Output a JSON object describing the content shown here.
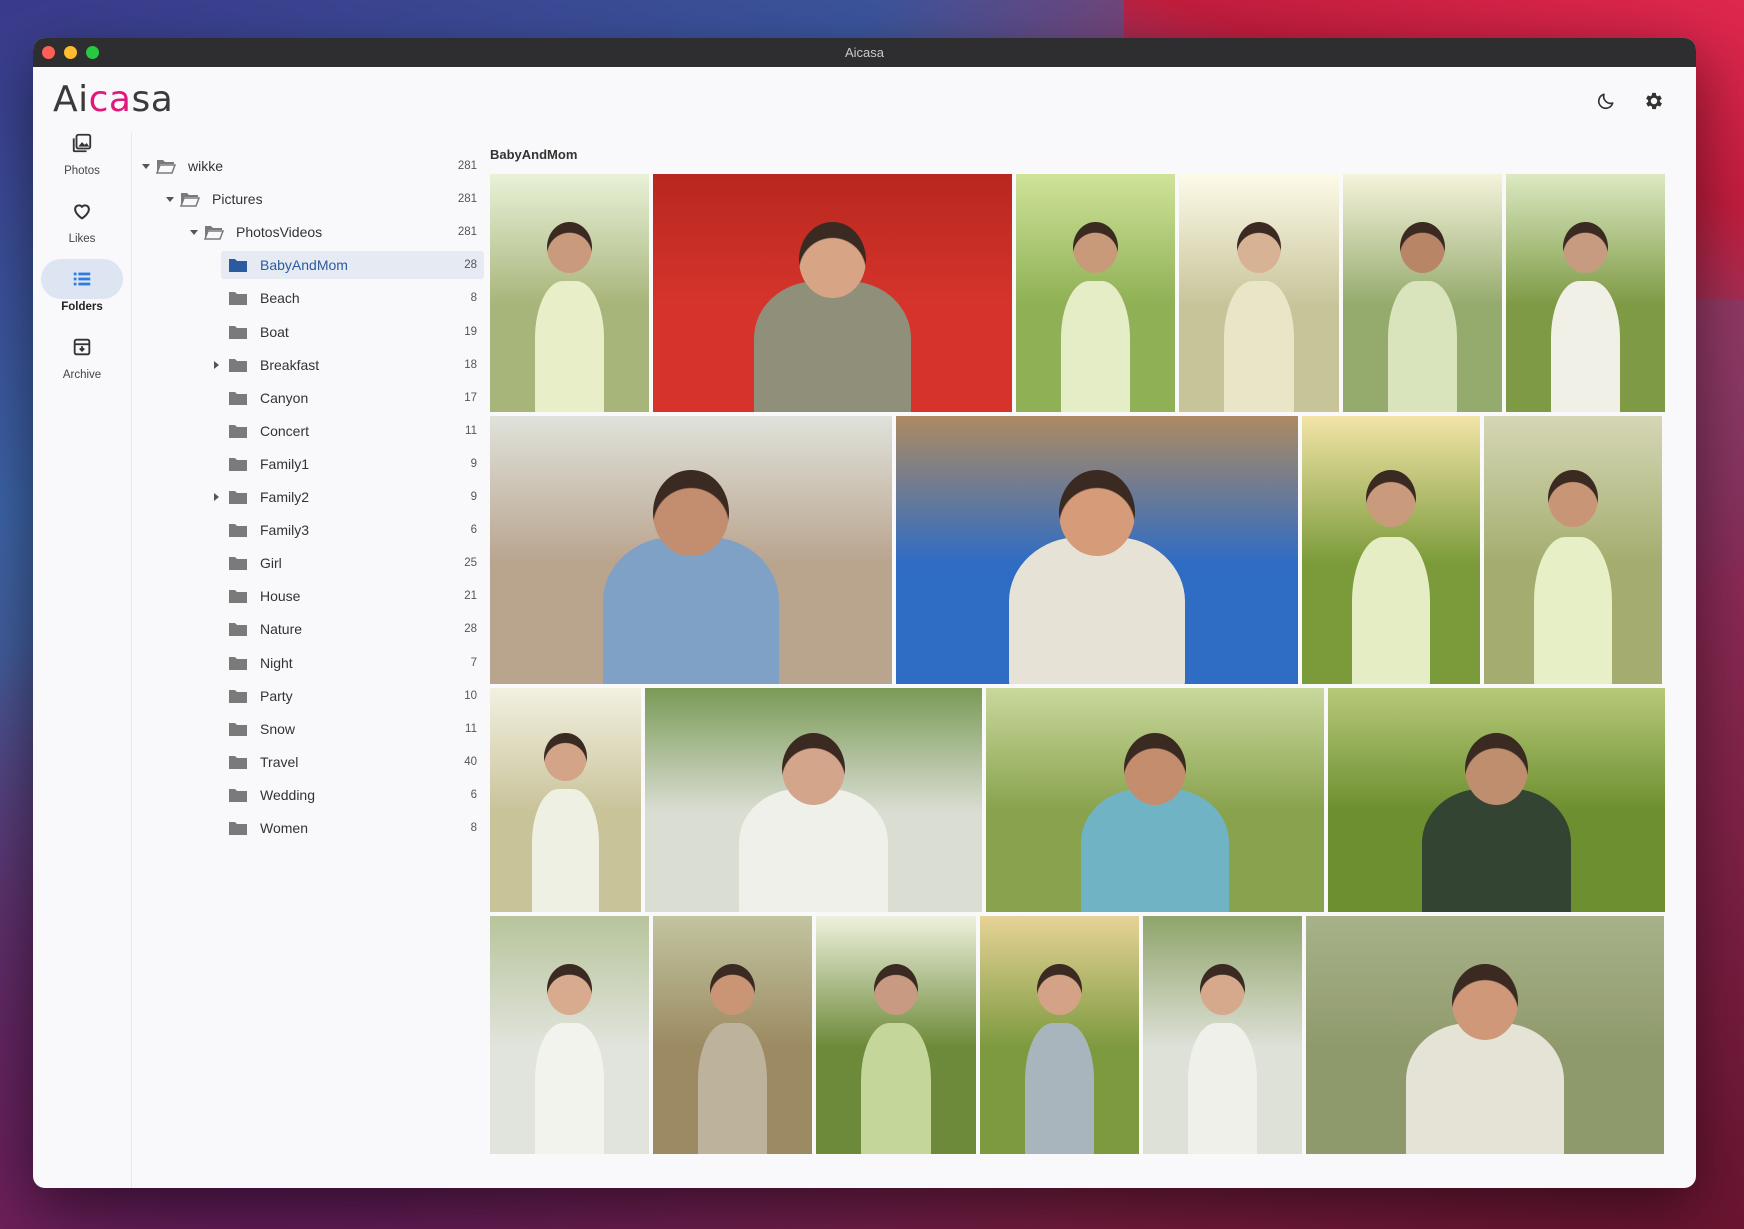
{
  "window": {
    "title": "Aicasa"
  },
  "app": {
    "logo_left": "Ai",
    "logo_accent": "ca",
    "logo_right": "sa"
  },
  "header": {
    "theme_icon": "moon-icon",
    "settings_icon": "gear-icon"
  },
  "nav": [
    {
      "label": "Photos",
      "icon": "photos-icon"
    },
    {
      "label": "Likes",
      "icon": "heart-icon"
    },
    {
      "label": "Folders",
      "icon": "folders-list-icon",
      "active": true
    },
    {
      "label": "Archive",
      "icon": "archive-icon"
    }
  ],
  "tree": [
    {
      "name": "wikke",
      "count": "281",
      "level": 0,
      "expanded": true,
      "open": true
    },
    {
      "name": "Pictures",
      "count": "281",
      "level": 1,
      "expanded": true,
      "open": true
    },
    {
      "name": "PhotosVideos",
      "count": "281",
      "level": 2,
      "expanded": true,
      "open": true
    },
    {
      "name": "BabyAndMom",
      "count": "28",
      "level": 3,
      "selected": true
    },
    {
      "name": "Beach",
      "count": "8",
      "level": 3
    },
    {
      "name": "Boat",
      "count": "19",
      "level": 3
    },
    {
      "name": "Breakfast",
      "count": "18",
      "level": 3,
      "collapsed": true
    },
    {
      "name": "Canyon",
      "count": "17",
      "level": 3
    },
    {
      "name": "Concert",
      "count": "11",
      "level": 3
    },
    {
      "name": "Family1",
      "count": "9",
      "level": 3
    },
    {
      "name": "Family2",
      "count": "9",
      "level": 3,
      "collapsed": true
    },
    {
      "name": "Family3",
      "count": "6",
      "level": 3
    },
    {
      "name": "Girl",
      "count": "25",
      "level": 3
    },
    {
      "name": "House",
      "count": "21",
      "level": 3
    },
    {
      "name": "Nature",
      "count": "28",
      "level": 3
    },
    {
      "name": "Night",
      "count": "7",
      "level": 3
    },
    {
      "name": "Party",
      "count": "10",
      "level": 3
    },
    {
      "name": "Snow",
      "count": "11",
      "level": 3
    },
    {
      "name": "Travel",
      "count": "40",
      "level": 3
    },
    {
      "name": "Wedding",
      "count": "6",
      "level": 3
    },
    {
      "name": "Women",
      "count": "8",
      "level": 3
    }
  ],
  "gallery": {
    "title": "BabyAndMom",
    "photos": [
      {
        "bg": "#a7b57a",
        "sky": "#e9f1d8",
        "subject": "#e8efc8",
        "skin": "#c99a7c"
      },
      {
        "bg": "#d6342b",
        "sky": "#b8271f",
        "subject": "#8f8f7a",
        "skin": "#d7a585"
      },
      {
        "bg": "#8fb054",
        "sky": "#cfe39a",
        "subject": "#e4edc6",
        "skin": "#c89a7a"
      },
      {
        "bg": "#c8c49a",
        "sky": "#fdfbe8",
        "subject": "#e9e6c7",
        "skin": "#d8b294"
      },
      {
        "bg": "#95ab6d",
        "sky": "#f5f3dc",
        "subject": "#d9e4bd",
        "skin": "#b98567"
      },
      {
        "bg": "#7e9a45",
        "sky": "#dce9c2",
        "subject": "#f0f0e6",
        "skin": "#c79b80"
      },
      {
        "bg": "#b9a48e",
        "sky": "#e0e2db",
        "subject": "#7ea1c5",
        "skin": "#c28e6f"
      },
      {
        "bg": "#2f6cc4",
        "sky": "#ad8a62",
        "subject": "#e6e2d5",
        "skin": "#d69c7a"
      },
      {
        "bg": "#7b9b3a",
        "sky": "#f3e4a8",
        "subject": "#e5edc4",
        "skin": "#c99a7c"
      },
      {
        "bg": "#a4ad6f",
        "sky": "#d5d7b5",
        "subject": "#e7efc6",
        "skin": "#c99577"
      },
      {
        "bg": "#c9c39a",
        "sky": "#f2f0e0",
        "subject": "#eef0e4",
        "skin": "#d4a488"
      },
      {
        "bg": "#d9ddd2",
        "sky": "#7a9a56",
        "subject": "#f0f0ea",
        "skin": "#d3a58a"
      },
      {
        "bg": "#88a24d",
        "sky": "#c9d89c",
        "subject": "#6fb3c4",
        "skin": "#c48e6e"
      },
      {
        "bg": "#6d8f2f",
        "sky": "#b7c97a",
        "subject": "#334433",
        "skin": "#bf8e6f"
      },
      {
        "bg": "#e1e4dc",
        "sky": "#b7c49b",
        "subject": "#f3f3ee",
        "skin": "#d9ab8e"
      },
      {
        "bg": "#9c8a62",
        "sky": "#c2c5a0",
        "subject": "#bdb39c",
        "skin": "#c99575"
      },
      {
        "bg": "#6d8a3a",
        "sky": "#eef1dd",
        "subject": "#c4d69a",
        "skin": "#c99a82"
      },
      {
        "bg": "#7e9a3f",
        "sky": "#e6d397",
        "subject": "#a9b5bd",
        "skin": "#d4a286"
      },
      {
        "bg": "#dde1d7",
        "sky": "#8fa46a",
        "subject": "#f0f0ea",
        "skin": "#d6a98c"
      },
      {
        "bg": "#8f9a6c",
        "sky": "#a8b28a",
        "subject": "#e5e2d6",
        "skin": "#cf9879"
      }
    ]
  }
}
